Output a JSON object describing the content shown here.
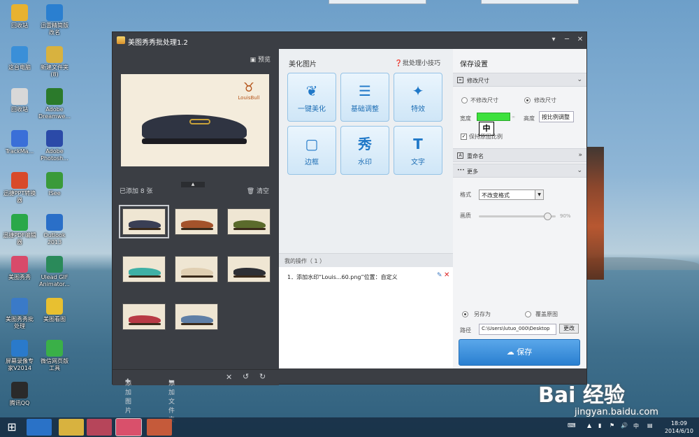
{
  "desktop": {
    "icons": [
      {
        "label": "回收站"
      },
      {
        "label": "迅雷精简版\n改名"
      },
      {
        "label": "这台电脑"
      },
      {
        "label": "新建文件夹\n(8)"
      },
      {
        "label": "回收站"
      },
      {
        "label": "Adobe\nDreamwe..."
      },
      {
        "label": "TrackMa..."
      },
      {
        "label": "Adobe\nPhotosh..."
      },
      {
        "label": "迅捷PPT转换\n器"
      },
      {
        "label": "ISee"
      },
      {
        "label": "迅捷PDF编辑\n器"
      },
      {
        "label": "Outlook\n2013"
      },
      {
        "label": "美图秀秀"
      },
      {
        "label": "Ulead GIF\nAnimator..."
      },
      {
        "label": "美图秀秀批\n处理"
      },
      {
        "label": "美图看图"
      },
      {
        "label": "屏幕录像专\n家V2014"
      },
      {
        "label": "微信网页版\n工具"
      },
      {
        "label": "腾讯QQ"
      }
    ]
  },
  "window": {
    "title": "美图秀秀批处理1.2",
    "controls": [
      "▾",
      "─",
      "✕"
    ]
  },
  "left": {
    "preview_label": "预览",
    "brand_text": "LouisBull",
    "added_count": "已添加 8 张",
    "clear_label": "清空",
    "add_image_label": "添加图片",
    "add_folder_label": "添加文件夹"
  },
  "thumbs": [
    {
      "color": "#3a3f55"
    },
    {
      "color": "#a4532b"
    },
    {
      "color": "#5b6b2c"
    },
    {
      "color": "#3fb0a5"
    },
    {
      "color": "#e0cfb2"
    },
    {
      "color": "#2d2f35"
    },
    {
      "color": "#b83a45"
    },
    {
      "color": "#5f7fa6"
    }
  ],
  "middle": {
    "heading": "美化图片",
    "tips": "批处理小技巧",
    "tools": [
      {
        "label": "一键美化",
        "icon": "tulip-icon"
      },
      {
        "label": "基础调整",
        "icon": "sliders-icon"
      },
      {
        "label": "特效",
        "icon": "magic-wand-icon"
      },
      {
        "label": "边框",
        "icon": "frame-icon"
      },
      {
        "label": "水印",
        "icon": "watermark-icon"
      },
      {
        "label": "文字",
        "icon": "text-icon"
      }
    ],
    "ops_title": "我的操作（ 1 ）",
    "op_item": "1．添加水印“Louis...60.png”位置：自定义"
  },
  "right": {
    "heading": "保存设置",
    "resize_section": "修改尺寸",
    "no_resize": "不修改尺寸",
    "resize": "修改尺寸",
    "width_label": "宽度",
    "height_label": "高度",
    "height_value": "按比例调整",
    "keep_ratio": "保持原图比例",
    "ime_char": "中",
    "rename_section": "重命名",
    "more_section": "更多",
    "format_label": "格式",
    "format_value": "不改变格式",
    "quality_label": "画质",
    "quality_value": "90%",
    "quality_level": 0.9,
    "save_as": "另存为",
    "overwrite": "覆盖原图",
    "path_label": "路径",
    "path_value": "C:\\Users\\lutuo_000\\Desktop",
    "change_label": "更改",
    "save_label": "保存"
  },
  "taskbar": {
    "ime": "中",
    "time": "18:09",
    "date": "2014/6/10"
  },
  "watermark": {
    "brand": "Bai 经验",
    "url": "jingyan.baidu.com"
  }
}
